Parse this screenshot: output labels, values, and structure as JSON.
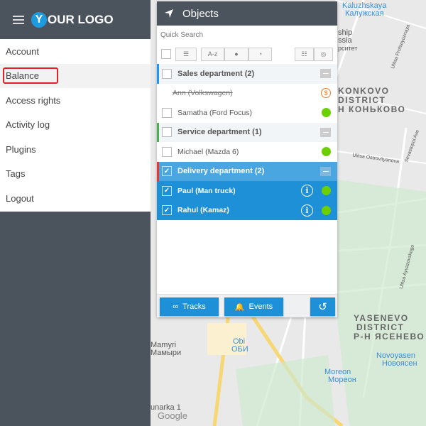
{
  "sidebar": {
    "logo_letter": "Y",
    "logo_text": "OUR LOGO",
    "menu": [
      {
        "label": "Account"
      },
      {
        "label": "Balance",
        "highlighted": true
      },
      {
        "label": "Access rights"
      },
      {
        "label": "Activity log"
      },
      {
        "label": "Plugins"
      },
      {
        "label": "Tags"
      },
      {
        "label": "Logout"
      }
    ]
  },
  "panel": {
    "title": "Objects",
    "search_placeholder": "Quick Search",
    "sort_az": "A-z",
    "groups": [
      {
        "name": "Sales department (2)",
        "color": "#2196f3",
        "checked": false,
        "items": [
          {
            "name": "Ann (Volkswagen)",
            "disabled": true,
            "status": "balance-warning"
          },
          {
            "name": "Samatha (Ford Focus)",
            "status": "online"
          }
        ]
      },
      {
        "name": "Service department (1)",
        "color": "#4caf50",
        "checked": false,
        "items": [
          {
            "name": "Michael (Mazda 6)",
            "status": "online"
          }
        ]
      },
      {
        "name": "Delivery department (2)",
        "color": "#e53935",
        "checked": true,
        "items": [
          {
            "name": "Paul (Man truck)",
            "status": "online"
          },
          {
            "name": "Rahul (Kamaz)",
            "status": "online"
          }
        ]
      }
    ],
    "footer": {
      "tracks": "Tracks",
      "events": "Events"
    }
  },
  "map": {
    "labels": {
      "kaluzhskaya": "Kaluzhskaya",
      "kaluzhskaya_ru": "Калужская",
      "ship": "ship",
      "ssia": "ssia",
      "rsitet": "рситет",
      "konkovo1": "KONKOVO",
      "konkovo2": "DISTRICT",
      "konkovo3": "Н КОНЬКОВО",
      "yasenevo1": "YASENEVO",
      "yasenevo2": "DISTRICT",
      "yasenevo3": "Р-Н ЯСЕНЕВО",
      "obi": "Obi",
      "obi_ru": "ОБИ",
      "mamyri": "Mamyri",
      "mamyri_ru": "Мамыри",
      "moreon": "Moreon",
      "moreon_ru": "Мореон",
      "novo": "Novoyasen",
      "novo_ru": "Новоясен",
      "kommunarka": "unarka 1",
      "google": "Google",
      "profsoyuznaya": "Ulitsa Profsoyuznaya",
      "ostrovityanova": "Ulitsa Ostrovityanova",
      "sevastopol": "Sevastopol Ave",
      "aivazovskogo": "Ulitsa Ayvazovskogo"
    },
    "accent": "#1e90d8"
  }
}
